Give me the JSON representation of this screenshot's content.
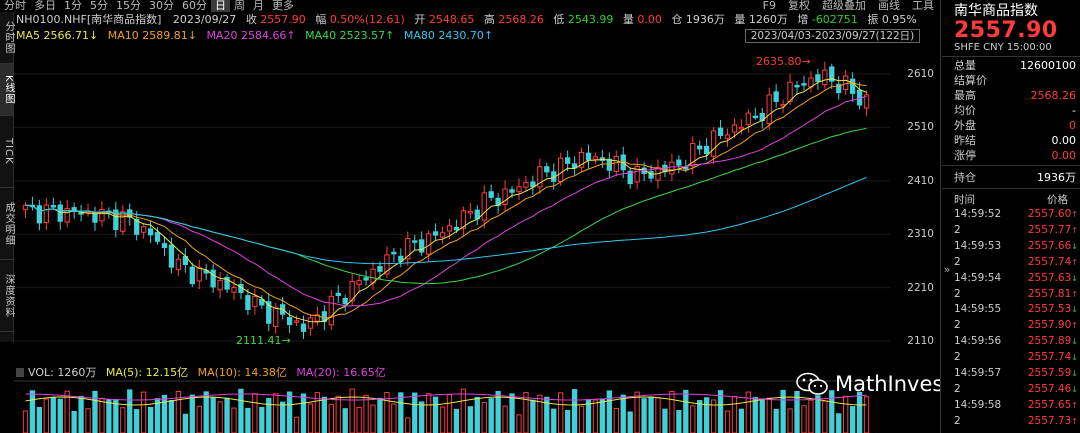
{
  "toolbar": {
    "periods": [
      "分时",
      "多日",
      "1分",
      "5分",
      "15分",
      "30分",
      "60分",
      "日",
      "周",
      "月",
      "更多"
    ],
    "active_period": "日",
    "right_buttons": [
      "F9",
      "复权",
      "超级叠加",
      "画线",
      "工具"
    ]
  },
  "left_tabs": [
    "分时图",
    "K线图",
    "TICK",
    "成交明细",
    "深度资料"
  ],
  "quote_row": {
    "symbol": "NH0100.NHF[南华商品指数]",
    "date": "2023/09/27",
    "close_label": "收",
    "close": "2557.90",
    "change_label": "幅",
    "change": "0.50%(12.61)",
    "open_label": "开",
    "open": "2548.65",
    "high_label": "高",
    "high": "2568.26",
    "low_label": "低",
    "low": "2543.99",
    "amount_label": "量",
    "amount": "0.00",
    "oi_label": "仓",
    "oi": "1936万",
    "vol_label": "量",
    "vol": "1260万",
    "oichg_label": "增",
    "oichg": "-602751",
    "amp_label": "振",
    "amp": "0.95%"
  },
  "ma_row": {
    "ma5": "MA5 2566.71↓",
    "ma10": "MA10 2589.81↓",
    "ma20": "MA20 2584.66↑",
    "ma40": "MA40 2523.57↑",
    "ma80": "MA80 2430.70↑"
  },
  "date_range": "2023/04/03-2023/09/27(122日)",
  "price_axis": [
    "2610",
    "2510",
    "2410",
    "2310",
    "2210",
    "2110"
  ],
  "annotations": {
    "high": "2635.80",
    "low": "2111.41"
  },
  "vol_row": {
    "vol": "VOL: 1260万",
    "ma5": "MA(5): 12.15亿",
    "ma10": "MA(10): 14.38亿",
    "ma20": "MA(20): 16.65亿"
  },
  "right_panel": {
    "title": "南华商品指数",
    "price": "2557.90",
    "sub": "SHFE  CNY  15:00:00",
    "stats": [
      {
        "k": "总量",
        "v": "12600100",
        "c": "white"
      },
      {
        "k": "结算价",
        "v": "",
        "c": "white"
      },
      {
        "k": "最高",
        "v": "2568.26",
        "c": "red"
      },
      {
        "k": "均价",
        "v": "-",
        "c": "white"
      },
      {
        "k": "外盘",
        "v": "0",
        "c": "red"
      },
      {
        "k": "昨结",
        "v": "0.00",
        "c": "white"
      },
      {
        "k": "涨停",
        "v": "0.00",
        "c": "red"
      }
    ],
    "oi_label": "持仓",
    "oi": "1936万",
    "tick_header": {
      "time": "时间",
      "price": "价格"
    },
    "ticks": [
      {
        "t": "14:59:52",
        "p": "2557.60",
        "dir": "up"
      },
      {
        "t": "2",
        "p": "2557.77",
        "dir": "up"
      },
      {
        "t": "14:59:53",
        "p": "2557.66",
        "dir": "down"
      },
      {
        "t": "2",
        "p": "2557.74",
        "dir": "up"
      },
      {
        "t": "14:59:54",
        "p": "2557.63",
        "dir": "down"
      },
      {
        "t": "2",
        "p": "2557.81",
        "dir": "up"
      },
      {
        "t": "14:59:55",
        "p": "2557.53",
        "dir": "down"
      },
      {
        "t": "2",
        "p": "2557.90",
        "dir": "up"
      },
      {
        "t": "14:59:56",
        "p": "2557.89",
        "dir": "down"
      },
      {
        "t": "2",
        "p": "2557.74",
        "dir": "down"
      },
      {
        "t": "14:59:57",
        "p": "2557.59",
        "dir": "down"
      },
      {
        "t": "2",
        "p": "2557.46",
        "dir": "down"
      },
      {
        "t": "14:59:58",
        "p": "2557.65",
        "dir": "up"
      },
      {
        "t": "2",
        "p": "2557.73",
        "dir": "up"
      }
    ]
  },
  "watermark": "MathInvestment",
  "colors": {
    "up": "#ff3b3b",
    "down": "#22d322",
    "candle_down": "#3fd0d8",
    "ma5": "#e9e94a",
    "ma10": "#f0a020",
    "ma20": "#e040e0",
    "ma40": "#3cd84a",
    "ma80": "#30c8f0"
  }
}
